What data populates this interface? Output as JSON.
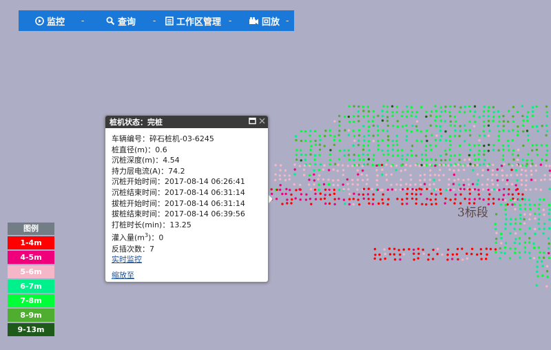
{
  "toolbar": {
    "items": [
      {
        "label": "监控",
        "icon": "play-circle-icon"
      },
      {
        "label": "查询",
        "icon": "search-icon"
      },
      {
        "label": "工作区管理",
        "icon": "list-icon"
      },
      {
        "label": "回放",
        "icon": "camera-icon"
      }
    ],
    "separator": "-"
  },
  "popup": {
    "title": "桩机状态：完桩",
    "rows": [
      "车辆编号：碎石桩机-03-6245",
      "桩直径(m)：0.6",
      "沉桩深度(m)：4.54",
      "持力层电流(A)：74.2",
      "沉桩开始时间：2017-08-14 06:26:41",
      "沉桩结束时间：2017-08-14 06:31:14",
      "拔桩开始时间：2017-08-14 06:31:14",
      "拔桩结束时间：2017-08-14 06:39:56",
      "打桩时长(min)：13.25"
    ],
    "fill_label": "灌入量(m",
    "fill_sup": "3",
    "fill_value": ")：0",
    "reinsert": "反插次数：7",
    "link_realtime": "实时监控",
    "link_zoom": "缩放至"
  },
  "map": {
    "segment_label": "3标段"
  },
  "legend": {
    "title": "图例",
    "items": [
      {
        "label": "1-4m",
        "color": "#ff0000"
      },
      {
        "label": "4-5m",
        "color": "#f0007a"
      },
      {
        "label": "5-6m",
        "color": "#f5b6c8"
      },
      {
        "label": "6-7m",
        "color": "#00f08c"
      },
      {
        "label": "7-8m",
        "color": "#00ff37"
      },
      {
        "label": "8-9m",
        "color": "#4fad30"
      },
      {
        "label": "9-13m",
        "color": "#1e5a19"
      }
    ]
  }
}
